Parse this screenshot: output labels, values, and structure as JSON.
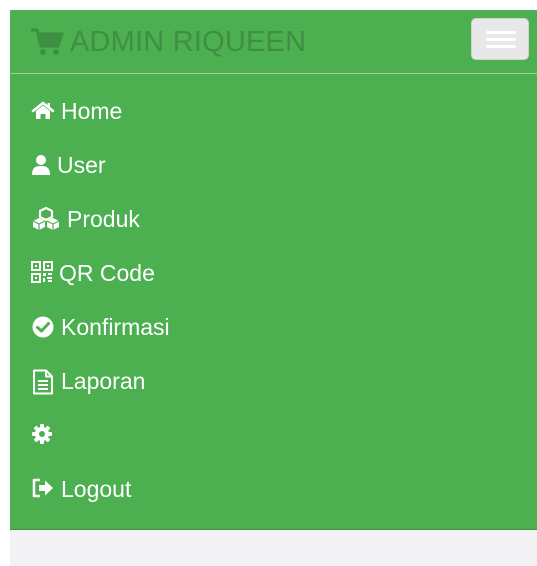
{
  "brand": {
    "title": "ADMIN RIQUEEN",
    "icon": "shopping-cart-icon"
  },
  "toggle": {
    "icon": "hamburger-menu-icon"
  },
  "colors": {
    "navbar": "#4caf50",
    "brand_text": "#3f8f43",
    "menu_text": "#ffffff",
    "page_background": "#f2f2f4"
  },
  "menu": [
    {
      "label": "Home",
      "icon": "home-icon"
    },
    {
      "label": "User",
      "icon": "user-icon"
    },
    {
      "label": "Produk",
      "icon": "cubes-icon"
    },
    {
      "label": "QR Code",
      "icon": "qrcode-icon"
    },
    {
      "label": "Konfirmasi",
      "icon": "check-circle-icon"
    },
    {
      "label": "Laporan",
      "icon": "file-text-icon"
    },
    {
      "label": "",
      "icon": "gear-icon"
    },
    {
      "label": "Logout",
      "icon": "sign-out-icon"
    }
  ]
}
